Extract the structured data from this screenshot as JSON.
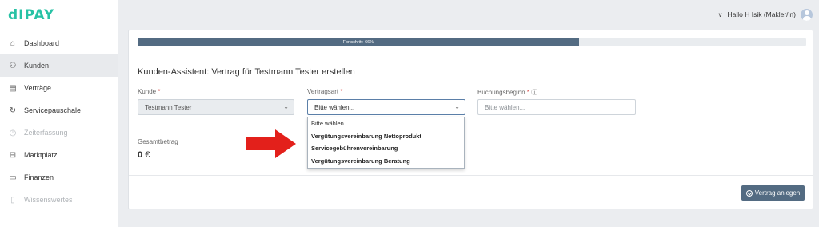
{
  "app": {
    "logo_text": "dIPAY",
    "brand_color": "#28c2a5"
  },
  "sidebar": {
    "items": [
      {
        "label": "Dashboard",
        "icon": "home-icon",
        "glyph": "⌂",
        "state": "normal"
      },
      {
        "label": "Kunden",
        "icon": "users-icon",
        "glyph": "⚇",
        "state": "active"
      },
      {
        "label": "Verträge",
        "icon": "document-icon",
        "glyph": "▤",
        "state": "normal"
      },
      {
        "label": "Servicepauschale",
        "icon": "refresh-icon",
        "glyph": "↻",
        "state": "normal"
      },
      {
        "label": "Zeiterfassung",
        "icon": "clock-icon",
        "glyph": "◷",
        "state": "disabled"
      },
      {
        "label": "Marktplatz",
        "icon": "store-icon",
        "glyph": "⊟",
        "state": "normal"
      },
      {
        "label": "Finanzen",
        "icon": "folder-icon",
        "glyph": "▭",
        "state": "normal"
      },
      {
        "label": "Wissenswertes",
        "icon": "book-icon",
        "glyph": "▯",
        "state": "disabled"
      }
    ]
  },
  "header": {
    "user_label": "Hallo H Isik (Makler/in)",
    "chevron_glyph": "∨"
  },
  "wizard": {
    "progress_text": "Fortschritt: 66%",
    "progress_percent": 66,
    "title": "Kunden-Assistent: Vertrag für Testmann Tester erstellen",
    "kunde": {
      "label": "Kunde",
      "required_mark": "*",
      "value": "Testmann Tester"
    },
    "vertragsart": {
      "label": "Vertragsart",
      "required_mark": "*",
      "value": "Bitte wählen...",
      "options": [
        "Bitte wählen...",
        "Vergütungsvereinbarung Nettoprodukt",
        "Servicegebührenvereinbarung",
        "Vergütungsvereinbarung Beratung"
      ]
    },
    "buchungsbeginn": {
      "label": "Buchungsbeginn",
      "required_mark": "*",
      "info_glyph": "ⓘ",
      "placeholder": "Bitte wählen..."
    },
    "total": {
      "label": "Gesamtbetrag",
      "amount": "0",
      "currency": "€"
    },
    "submit_label": "Vertrag anlegen"
  },
  "colors": {
    "primary": "#536b82",
    "required": "#d9534f",
    "arrow": "#e3201b"
  }
}
